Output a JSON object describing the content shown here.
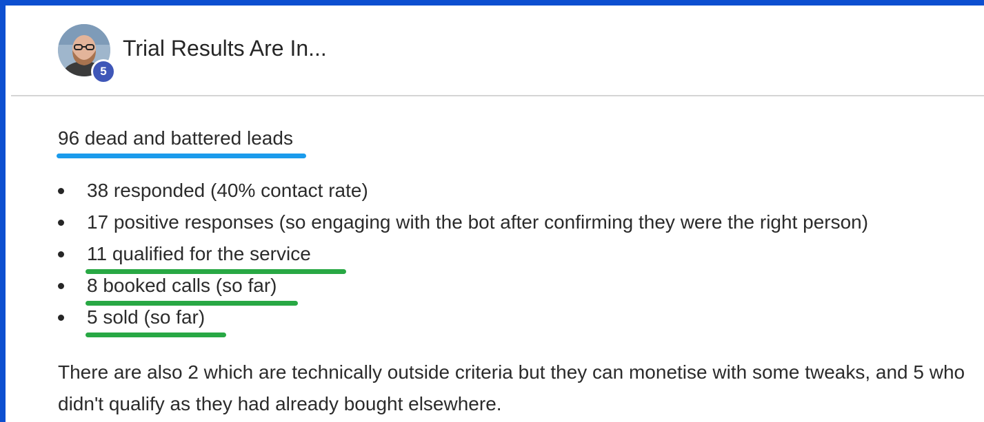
{
  "post": {
    "title": "Trial Results Are In...",
    "author_badge": "5",
    "lead": "96 dead and battered leads",
    "items": [
      "38 responded (40% contact rate)",
      "17 positive responses (so engaging with the bot after confirming they were the right person)",
      "11 qualified for the service",
      "8 booked calls (so far)",
      "5 sold (so far)"
    ],
    "paragraph": "There are also 2 which are technically outside criteria but they can monetise with some tweaks, and 5 who didn't qualify as they had already bought elsewhere."
  },
  "colors": {
    "frame": "#0d4fd0",
    "underline_lead": "#1b9bec",
    "underline_items": "#28a844",
    "badge": "#3f57b8"
  }
}
